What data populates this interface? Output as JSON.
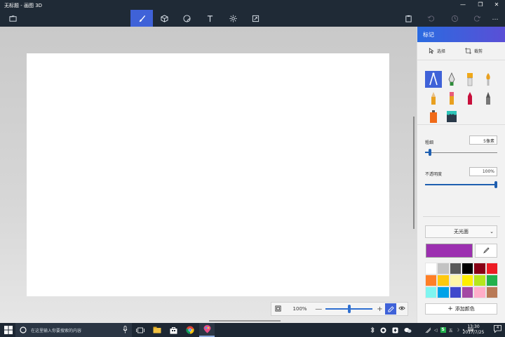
{
  "window": {
    "title": "无标题 - 画图 3D",
    "minimize_glyph": "—",
    "maximize_glyph": "❐",
    "close_glyph": "✕"
  },
  "toolbar": {
    "tools": [
      {
        "name": "brush-tool-icon",
        "active": true
      },
      {
        "name": "3d-objects-icon",
        "active": false
      },
      {
        "name": "stickers-icon",
        "active": false
      },
      {
        "name": "text-tool-icon",
        "active": false
      },
      {
        "name": "effects-icon",
        "active": false
      },
      {
        "name": "canvas-icon",
        "active": false
      }
    ],
    "right": [
      "paste-icon",
      "undo-icon",
      "history-icon",
      "redo-icon",
      "more-icon"
    ]
  },
  "zoom": {
    "value": "100%",
    "minus": "—",
    "plus": "+",
    "level": 0.5
  },
  "panel": {
    "title": "标记",
    "select_label": "选择",
    "crop_label": "裁剪",
    "thickness_label": "粗细",
    "thickness_value": "5像素",
    "thickness_level": 0.05,
    "opacity_label": "不透明度",
    "opacity_value": "100%",
    "opacity_level": 1.0,
    "finish_label": "无光面",
    "finish_chevron": "⌄",
    "current_color": "#9c2fb0",
    "palette": [
      "#ffffff",
      "#c3c3c3",
      "#595959",
      "#000000",
      "#880015",
      "#ed1c24",
      "#ff7f27",
      "#ffc90e",
      "#fff6a8",
      "#ffef00",
      "#b5e61d",
      "#22b14c",
      "#7ff5f0",
      "#00a2e8",
      "#3f48cc",
      "#a349a4",
      "#ffaec9",
      "#b97a57"
    ],
    "add_color_label": "添加颜色",
    "add_color_plus": "+"
  },
  "taskbar": {
    "search_placeholder": "在这里输入你要搜索的内容",
    "clock_time": "13:30",
    "clock_date": "2017/7/25",
    "ime_char": "五",
    "ime_s": "S",
    "notif_count": "4"
  },
  "colors": {
    "accent": "#3f62d8",
    "titlebar": "#1f2a36",
    "panel_header_start": "#2a6be0",
    "panel_header_end": "#5a4fd6"
  }
}
